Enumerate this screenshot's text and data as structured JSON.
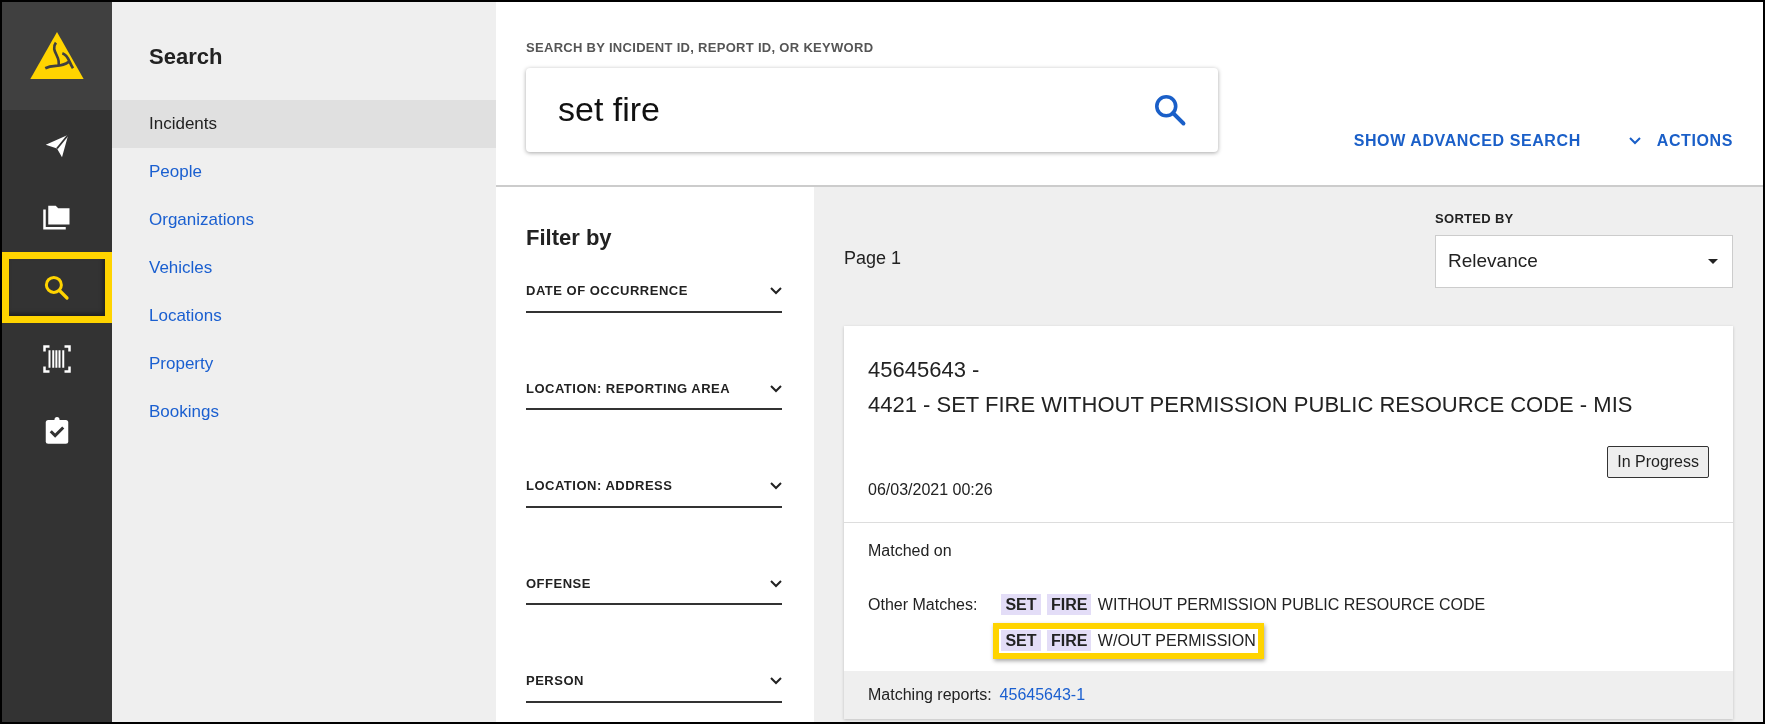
{
  "rail": {
    "logo": {
      "kind": "triangle"
    },
    "items": [
      {
        "kind": "send",
        "highlighted": false
      },
      {
        "kind": "folder",
        "highlighted": false
      },
      {
        "kind": "search",
        "highlighted": true
      },
      {
        "kind": "barcode",
        "highlighted": false
      },
      {
        "kind": "clipboard",
        "highlighted": false
      }
    ]
  },
  "sidebar": {
    "title": "Search",
    "items": [
      {
        "label": "Incidents",
        "selected": true
      },
      {
        "label": "People",
        "selected": false
      },
      {
        "label": "Organizations",
        "selected": false
      },
      {
        "label": "Vehicles",
        "selected": false
      },
      {
        "label": "Locations",
        "selected": false
      },
      {
        "label": "Property",
        "selected": false
      },
      {
        "label": "Bookings",
        "selected": false
      }
    ]
  },
  "search": {
    "label": "SEARCH BY INCIDENT ID, REPORT ID, OR KEYWORD",
    "value": "set fire",
    "advanced_button": "SHOW ADVANCED SEARCH",
    "actions_button": "ACTIONS"
  },
  "filters": {
    "title": "Filter by",
    "items": [
      {
        "label": "DATE OF OCCURRENCE",
        "expanded": false
      },
      {
        "label": "LOCATION: REPORTING AREA",
        "expanded": false
      },
      {
        "label": "LOCATION: ADDRESS",
        "expanded": false
      },
      {
        "label": "OFFENSE",
        "expanded": false
      },
      {
        "label": "PERSON",
        "expanded": false
      }
    ]
  },
  "results": {
    "page": "Page 1",
    "sort_label": "SORTED BY",
    "sort_value": "Relevance",
    "cards": [
      {
        "id_line": "45645643 -",
        "title": "4421 - SET FIRE WITHOUT PERMISSION PUBLIC RESOURCE CODE - MIS",
        "status": "In Progress",
        "date": "06/03/2021 00:26",
        "matched_on": "Matched on",
        "other_label": "Other Matches:",
        "matches": [
          {
            "terms": [
              "SET",
              "FIRE"
            ],
            "rest": "WITHOUT PERMISSION PUBLIC RESOURCE CODE",
            "highlighted": false
          },
          {
            "terms": [
              "SET",
              "FIRE"
            ],
            "rest": "W/OUT PERMISSION",
            "highlighted": true
          }
        ],
        "reports_label": "Matching reports:",
        "report_link": "45645643-1"
      }
    ]
  }
}
